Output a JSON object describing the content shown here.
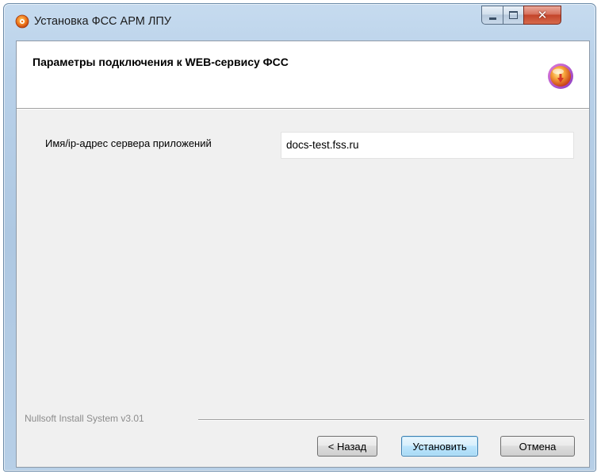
{
  "window": {
    "title": "Установка ФСС АРМ ЛПУ",
    "controls": {
      "minimize": "minimize",
      "maximize": "maximize",
      "close": "close"
    }
  },
  "header": {
    "title": "Параметры подключения к WEB-сервису ФСС",
    "icon": "installer-disc-icon"
  },
  "form": {
    "server_label": "Имя/ip-адрес сервера приложений",
    "server_value": "docs-test.fss.ru"
  },
  "footer": {
    "branding": "Nullsoft Install System v3.01",
    "back_label": "< Назад",
    "install_label": "Установить",
    "cancel_label": "Отмена"
  },
  "colors": {
    "accent": "#3c7fb1",
    "close_red": "#c3442a",
    "icon_orange": "#f07b1e"
  }
}
